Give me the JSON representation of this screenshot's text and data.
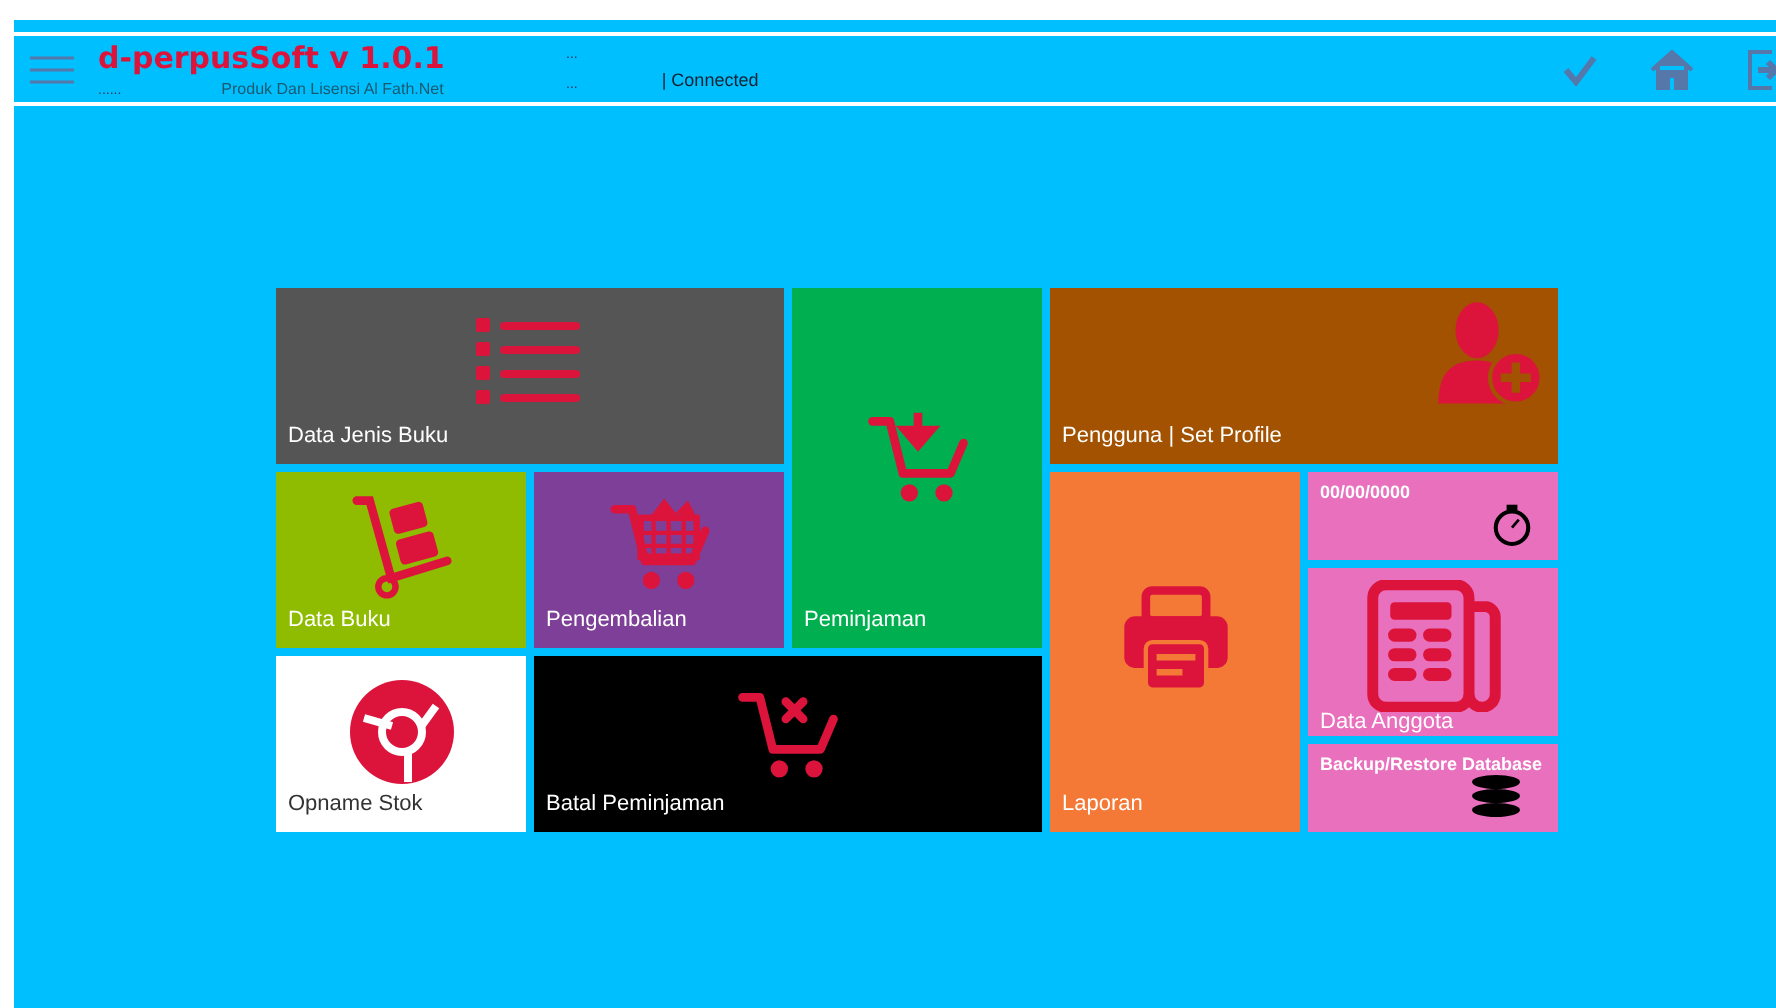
{
  "header": {
    "title": "d-perpusSoft v 1.0.1",
    "title_dots": "......",
    "subtitle": "Produk Dan Lisensi Al Fath.Net",
    "dots_top": "...",
    "dots_bottom": "...",
    "status": "| Connected"
  },
  "tiles": [
    {
      "label": "Data Jenis Buku",
      "color": "#555555",
      "kind": "list"
    },
    {
      "label": "Peminjaman",
      "color": "#00b050",
      "kind": "cart-in"
    },
    {
      "label": "Pengguna | Set Profile",
      "color": "#a25200",
      "kind": "user-add"
    },
    {
      "label": "Data Buku",
      "color": "#8fbc00",
      "kind": "trolley"
    },
    {
      "label": "Pengembalian",
      "color": "#7d3f98",
      "kind": "basket"
    },
    {
      "label": "Laporan",
      "color": "#f47836",
      "kind": "printer"
    },
    {
      "label": "00/00/0000",
      "color": "#e870bd",
      "kind": "timer"
    },
    {
      "label": "Data Anggota",
      "color": "#e870bd",
      "kind": "news"
    },
    {
      "label": "Backup/Restore Database",
      "color": "#e870bd",
      "kind": "database"
    },
    {
      "label": "Opname Stok",
      "color": "#ffffff",
      "kind": "disc"
    },
    {
      "label": "Batal Peminjaman",
      "color": "#000000",
      "kind": "cart-x"
    }
  ]
}
